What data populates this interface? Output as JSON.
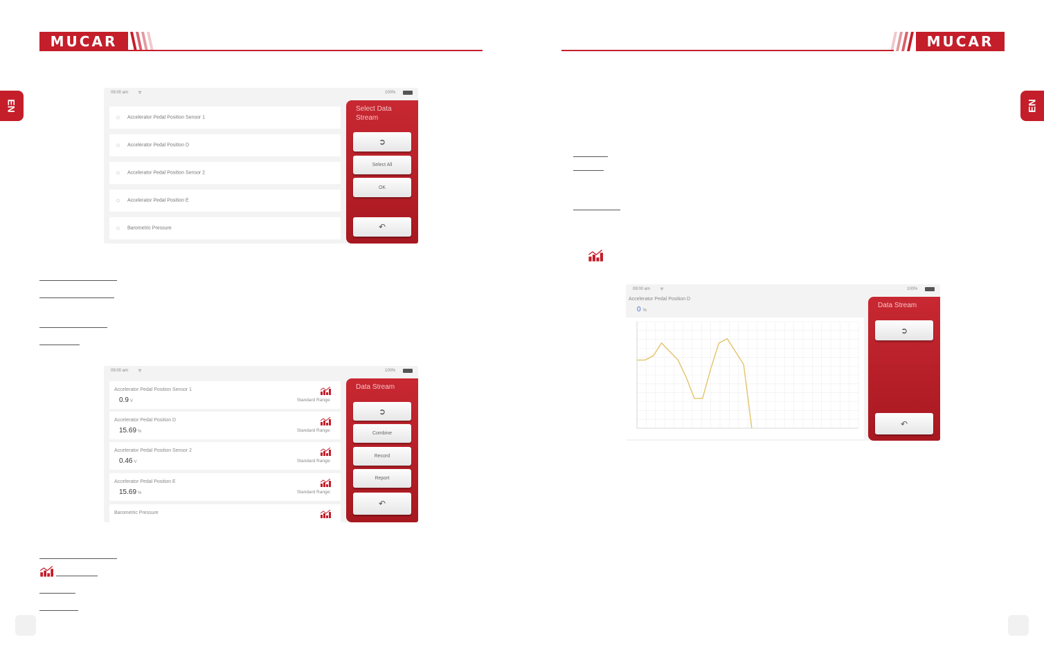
{
  "brand": {
    "logo_text": "MUCAR",
    "color": "#c41e2a"
  },
  "side_tab": {
    "left": "EN",
    "right": "EN"
  },
  "screen_select": {
    "status_time": "09:00 am",
    "battery": "100%",
    "items": [
      "Accelerator Pedal Position Sensor 1",
      "Accelerator Pedal Position D",
      "Accelerator Pedal Position Sensor 2",
      "Accelerator Pedal Position E",
      "Barometric Pressure"
    ],
    "panel_title": "Select Data Stream",
    "buttons": {
      "select_all": "Select All",
      "ok": "OK"
    }
  },
  "screen_stream": {
    "status_time": "09:00 am",
    "battery": "100%",
    "rows": [
      {
        "name": "Accelerator Pedal Position Sensor 1",
        "value": "0.9",
        "unit": "V",
        "range": "Standard Range:"
      },
      {
        "name": "Accelerator Pedal Position D",
        "value": "15.69",
        "unit": "%",
        "range": "Standard Range:"
      },
      {
        "name": "Accelerator Pedal Position Sensor 2",
        "value": "0.46",
        "unit": "V",
        "range": "Standard Range:"
      },
      {
        "name": "Accelerator Pedal Position E",
        "value": "15.69",
        "unit": "%",
        "range": "Standard Range:"
      },
      {
        "name": "Barometric Pressure",
        "value": "",
        "unit": "",
        "range": ""
      }
    ],
    "panel_title": "Data Stream",
    "buttons": {
      "combine": "Combine",
      "record": "Record",
      "report": "Report"
    }
  },
  "screen_graph": {
    "status_time": "09:00 am",
    "battery": "100%",
    "pid_name": "Accelerator Pedal Position D",
    "value": "0",
    "unit": "%",
    "panel_title": "Data Stream"
  },
  "chart_data": {
    "type": "line",
    "title": "",
    "xlabel": "",
    "ylabel": "",
    "x": [
      0,
      1,
      2,
      3,
      4,
      5,
      6,
      7,
      8,
      9,
      10,
      11,
      12,
      13,
      14,
      15,
      16,
      17,
      18,
      19,
      20,
      21,
      22,
      23,
      24,
      25,
      26,
      27
    ],
    "series": [
      {
        "values": [
          16,
          16,
          17,
          20,
          18,
          16,
          12,
          7,
          7,
          14,
          20,
          21,
          18,
          15,
          0,
          null,
          null,
          null,
          null,
          null,
          null,
          null,
          null,
          null,
          null,
          null,
          null,
          null
        ],
        "color": "#e2c36a"
      }
    ],
    "ylim": [
      0,
      25
    ],
    "grid": true
  }
}
